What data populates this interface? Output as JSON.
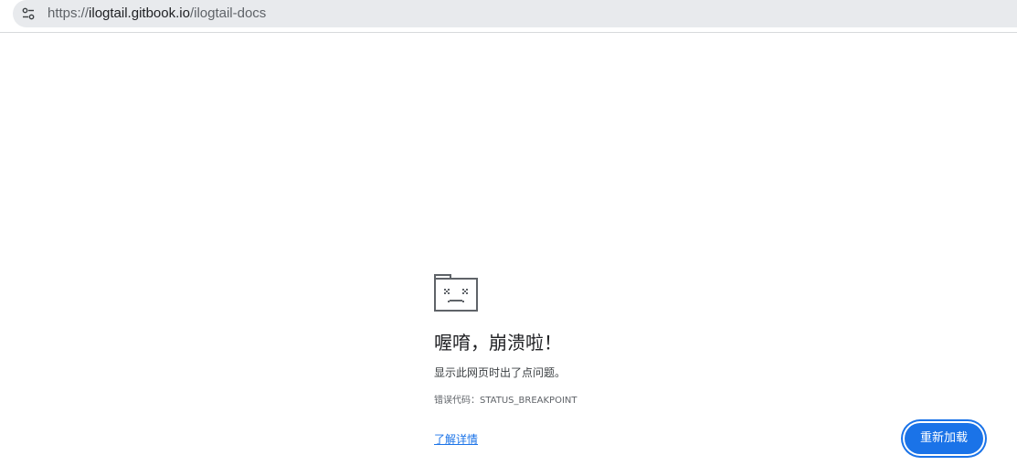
{
  "omnibox": {
    "icon": "tune-icon",
    "url_scheme": "https://",
    "url_host": "ilogtail.gitbook.io",
    "url_path": "/ilogtail-docs"
  },
  "error_page": {
    "icon": "sad-tab-icon",
    "title": "喔唷，崩溃啦！",
    "message": "显示此网页时出了点问题。",
    "error_code": "错误代码：STATUS_BREAKPOINT",
    "learn_more": "了解详情",
    "reload_label": "重新加载"
  },
  "colors": {
    "accent": "#1a73e8",
    "omnibox_bg": "#e8eaed",
    "icon_gray": "#5f6368"
  }
}
